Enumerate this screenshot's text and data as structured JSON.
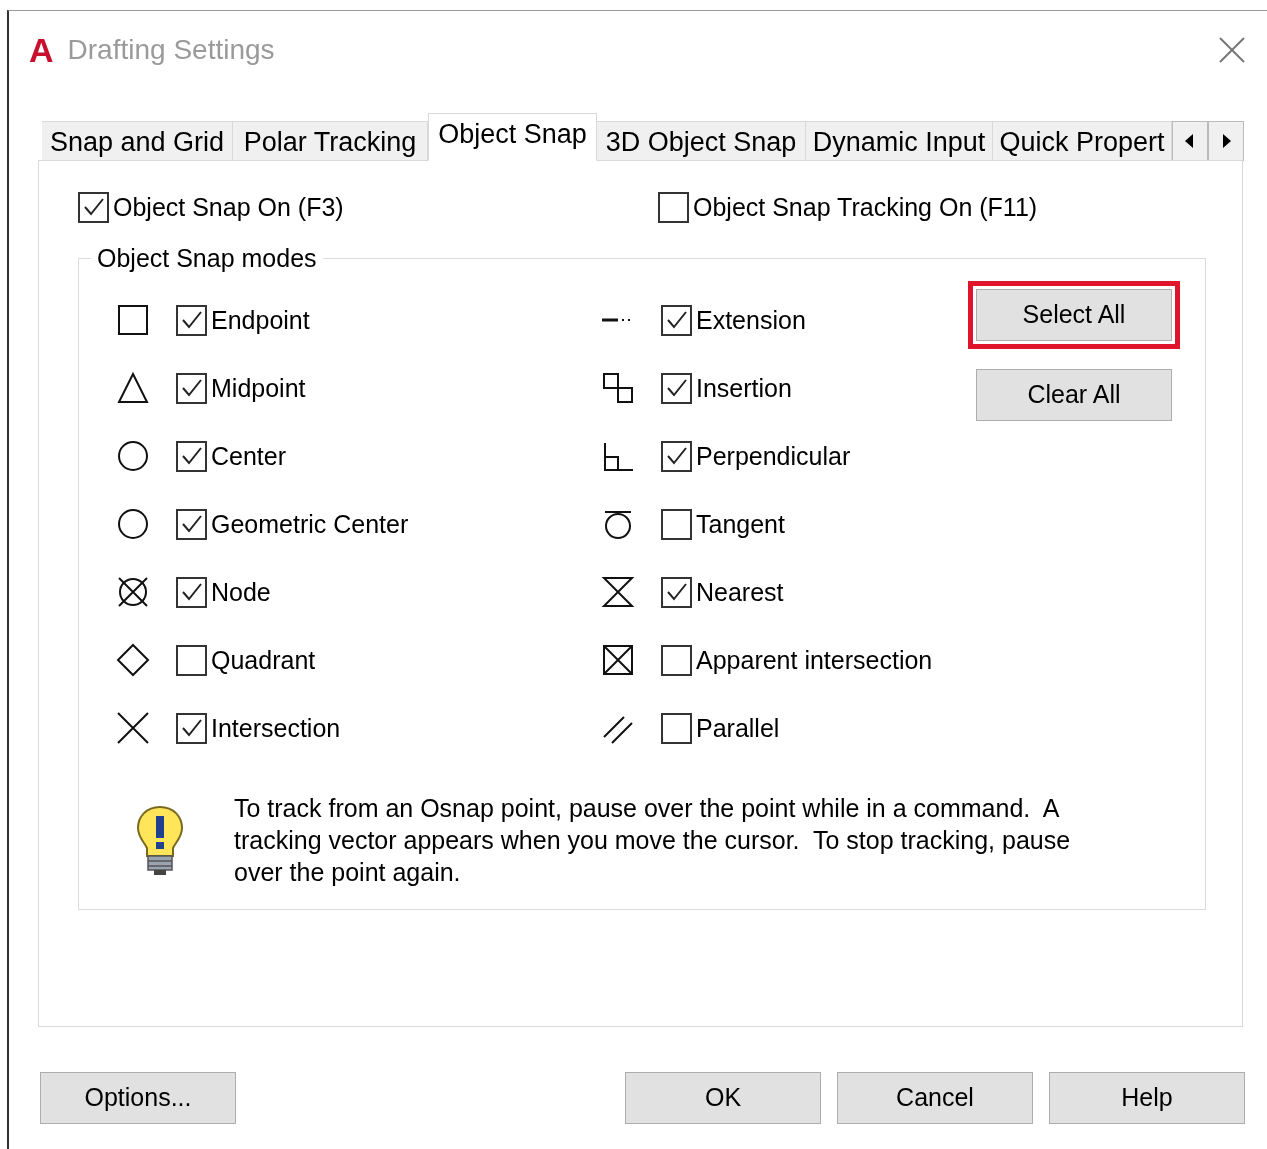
{
  "window": {
    "logo": "A",
    "title": "Drafting Settings"
  },
  "tabs": [
    {
      "label": "Snap and Grid",
      "selected": false
    },
    {
      "label": "Polar Tracking",
      "selected": false
    },
    {
      "label": "Object Snap",
      "selected": true
    },
    {
      "label": "3D Object Snap",
      "selected": false
    },
    {
      "label": "Dynamic Input",
      "selected": false
    },
    {
      "label": "Quick Propert",
      "selected": false
    }
  ],
  "top_checkboxes": [
    {
      "label": "Object Snap On (F3)",
      "checked": true
    },
    {
      "label": "Object Snap Tracking On (F11)",
      "checked": false
    }
  ],
  "modes_group": {
    "title": "Object Snap modes",
    "columns": [
      [
        {
          "kind": "endpoint",
          "label": "Endpoint",
          "checked": true
        },
        {
          "kind": "midpoint",
          "label": "Midpoint",
          "checked": true
        },
        {
          "kind": "center",
          "label": "Center",
          "checked": true
        },
        {
          "kind": "geocenter",
          "label": "Geometric Center",
          "checked": true
        },
        {
          "kind": "node",
          "label": "Node",
          "checked": true
        },
        {
          "kind": "quadrant",
          "label": "Quadrant",
          "checked": false
        },
        {
          "kind": "intersection",
          "label": "Intersection",
          "checked": true
        }
      ],
      [
        {
          "kind": "extension",
          "label": "Extension",
          "checked": true
        },
        {
          "kind": "insertion",
          "label": "Insertion",
          "checked": true
        },
        {
          "kind": "perpendicular",
          "label": "Perpendicular",
          "checked": true
        },
        {
          "kind": "tangent",
          "label": "Tangent",
          "checked": false
        },
        {
          "kind": "nearest",
          "label": "Nearest",
          "checked": true
        },
        {
          "kind": "apparent",
          "label": "Apparent intersection",
          "checked": false
        },
        {
          "kind": "parallel",
          "label": "Parallel",
          "checked": false
        }
      ]
    ],
    "buttons": [
      {
        "label": "Select All",
        "highlighted": true
      },
      {
        "label": "Clear All",
        "highlighted": false
      }
    ],
    "hint": "To track from an Osnap point, pause over the point while in a command.  A tracking vector appears when you move the cursor.  To stop tracking, pause over the point again."
  },
  "footer_buttons": [
    "Options...",
    "OK",
    "Cancel",
    "Help"
  ]
}
